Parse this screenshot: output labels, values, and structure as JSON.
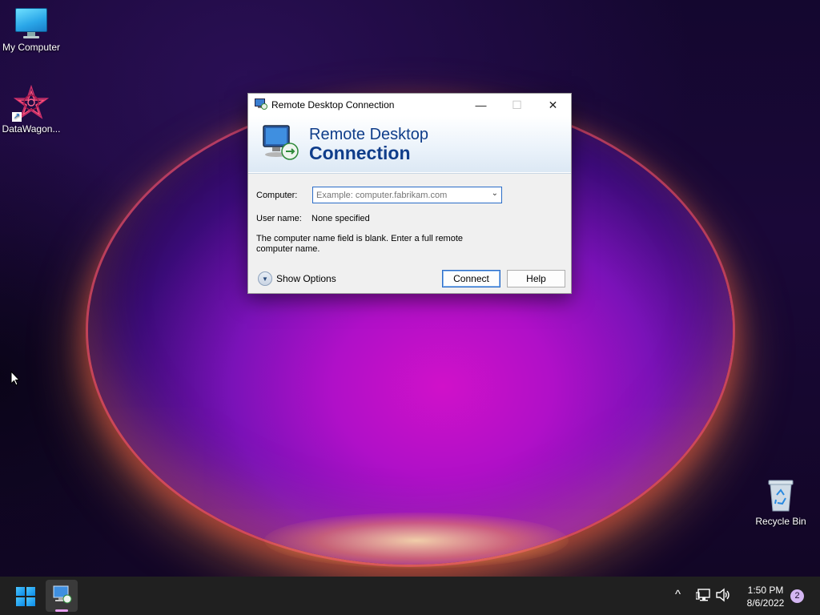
{
  "desktop": {
    "icons": [
      {
        "label": "My Computer"
      },
      {
        "label": "DataWagon..."
      },
      {
        "label": "Recycle Bin"
      }
    ]
  },
  "window": {
    "title": "Remote Desktop Connection",
    "controls": {
      "minimize": "—",
      "maximize": "☐",
      "close": "✕"
    },
    "banner": {
      "line1": "Remote Desktop",
      "line2": "Connection"
    },
    "computer_label": "Computer:",
    "computer_placeholder": "Example: computer.fabrikam.com",
    "computer_value": "",
    "username_label": "User name:",
    "username_value": "None specified",
    "message": "The computer name field is blank. Enter a full remote computer name.",
    "show_options_label": "Show Options",
    "connect_label": "Connect",
    "help_label": "Help"
  },
  "taskbar": {
    "tray": {
      "chevron": "^"
    },
    "time": "1:50 PM",
    "date": "8/6/2022",
    "notification_count": "2"
  },
  "colors": {
    "accent": "#2a6cc8",
    "banner_text": "#0f3d8a",
    "taskbar": "#202020"
  }
}
